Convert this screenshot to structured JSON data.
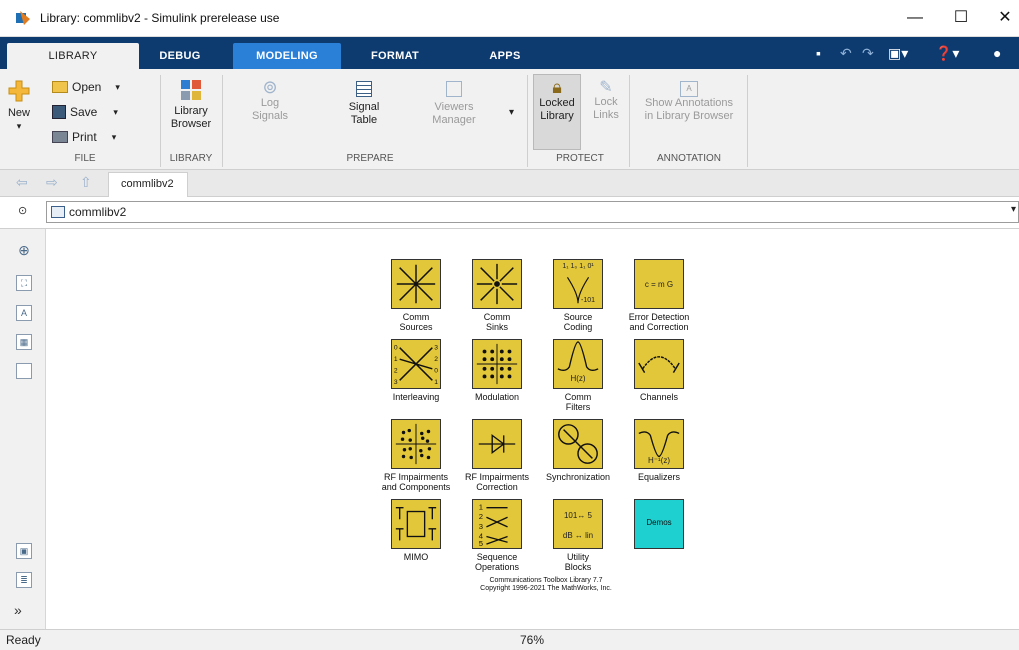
{
  "window": {
    "title": "Library: commlibv2 - Simulink prerelease use",
    "minimize": "—",
    "maximize": "☐",
    "close": "✕"
  },
  "ribbon_tabs": [
    "LIBRARY",
    "DEBUG",
    "MODELING",
    "FORMAT",
    "APPS"
  ],
  "active_tab": "LIBRARY",
  "ribbon": {
    "file": {
      "label": "FILE",
      "new": "New",
      "open": "Open",
      "save": "Save",
      "print": "Print"
    },
    "library": {
      "label": "LIBRARY",
      "browser_line1": "Library",
      "browser_line2": "Browser"
    },
    "prepare": {
      "label": "PREPARE",
      "log_line1": "Log",
      "log_line2": "Signals",
      "table_line1": "Signal",
      "table_line2": "Table",
      "viewers_line1": "Viewers",
      "viewers_line2": "Manager"
    },
    "protect": {
      "label": "PROTECT",
      "locked_line1": "Locked",
      "locked_line2": "Library",
      "lock_line1": "Lock",
      "lock_line2": "Links"
    },
    "annotation": {
      "label": "ANNOTATION",
      "show_line1": "Show Annotations",
      "show_line2": "in Library Browser"
    }
  },
  "nav": {
    "tab": "commlibv2"
  },
  "address": {
    "path": "commlibv2"
  },
  "blocks": [
    {
      "line1": "Comm",
      "line2": "Sources"
    },
    {
      "line1": "Comm",
      "line2": "Sinks"
    },
    {
      "line1": "Source",
      "line2": "Coding"
    },
    {
      "line1": "Error Detection",
      "line2": "and Correction"
    },
    {
      "line1": "Interleaving",
      "line2": ""
    },
    {
      "line1": "Modulation",
      "line2": ""
    },
    {
      "line1": "Comm",
      "line2": "Filters"
    },
    {
      "line1": "Channels",
      "line2": ""
    },
    {
      "line1": "RF Impairments",
      "line2": "and Components"
    },
    {
      "line1": "RF Impairments",
      "line2": "Correction"
    },
    {
      "line1": "Synchronization",
      "line2": ""
    },
    {
      "line1": "Equalizers",
      "line2": ""
    },
    {
      "line1": "MIMO",
      "line2": ""
    },
    {
      "line1": "Sequence",
      "line2": "Operations"
    },
    {
      "line1": "Utility",
      "line2": "Blocks"
    },
    {
      "line1": "",
      "line2": ""
    }
  ],
  "block_icons": {
    "error_detection": "c = m G",
    "filters": "H(z)",
    "equalizers": "H⁻¹(z)",
    "source_coding_top": "1₁ 1₀ 1₁ 0¹",
    "source_coding_bottom": "-101",
    "util_top": "101↔ 5",
    "util_bottom": "dB ↔ lin",
    "demos": "Demos"
  },
  "copyright": {
    "line1": "Communications Toolbox Library 7.7",
    "line2": "Copyright 1996-2021 The MathWorks, Inc."
  },
  "status": {
    "ready": "Ready",
    "zoom": "76%"
  },
  "colors": {
    "ribbon_dark": "#0d3b70",
    "modeling_tab": "#2a7fd6",
    "block_yellow": "#e3c73a",
    "demos_cyan": "#1fd0d0"
  }
}
